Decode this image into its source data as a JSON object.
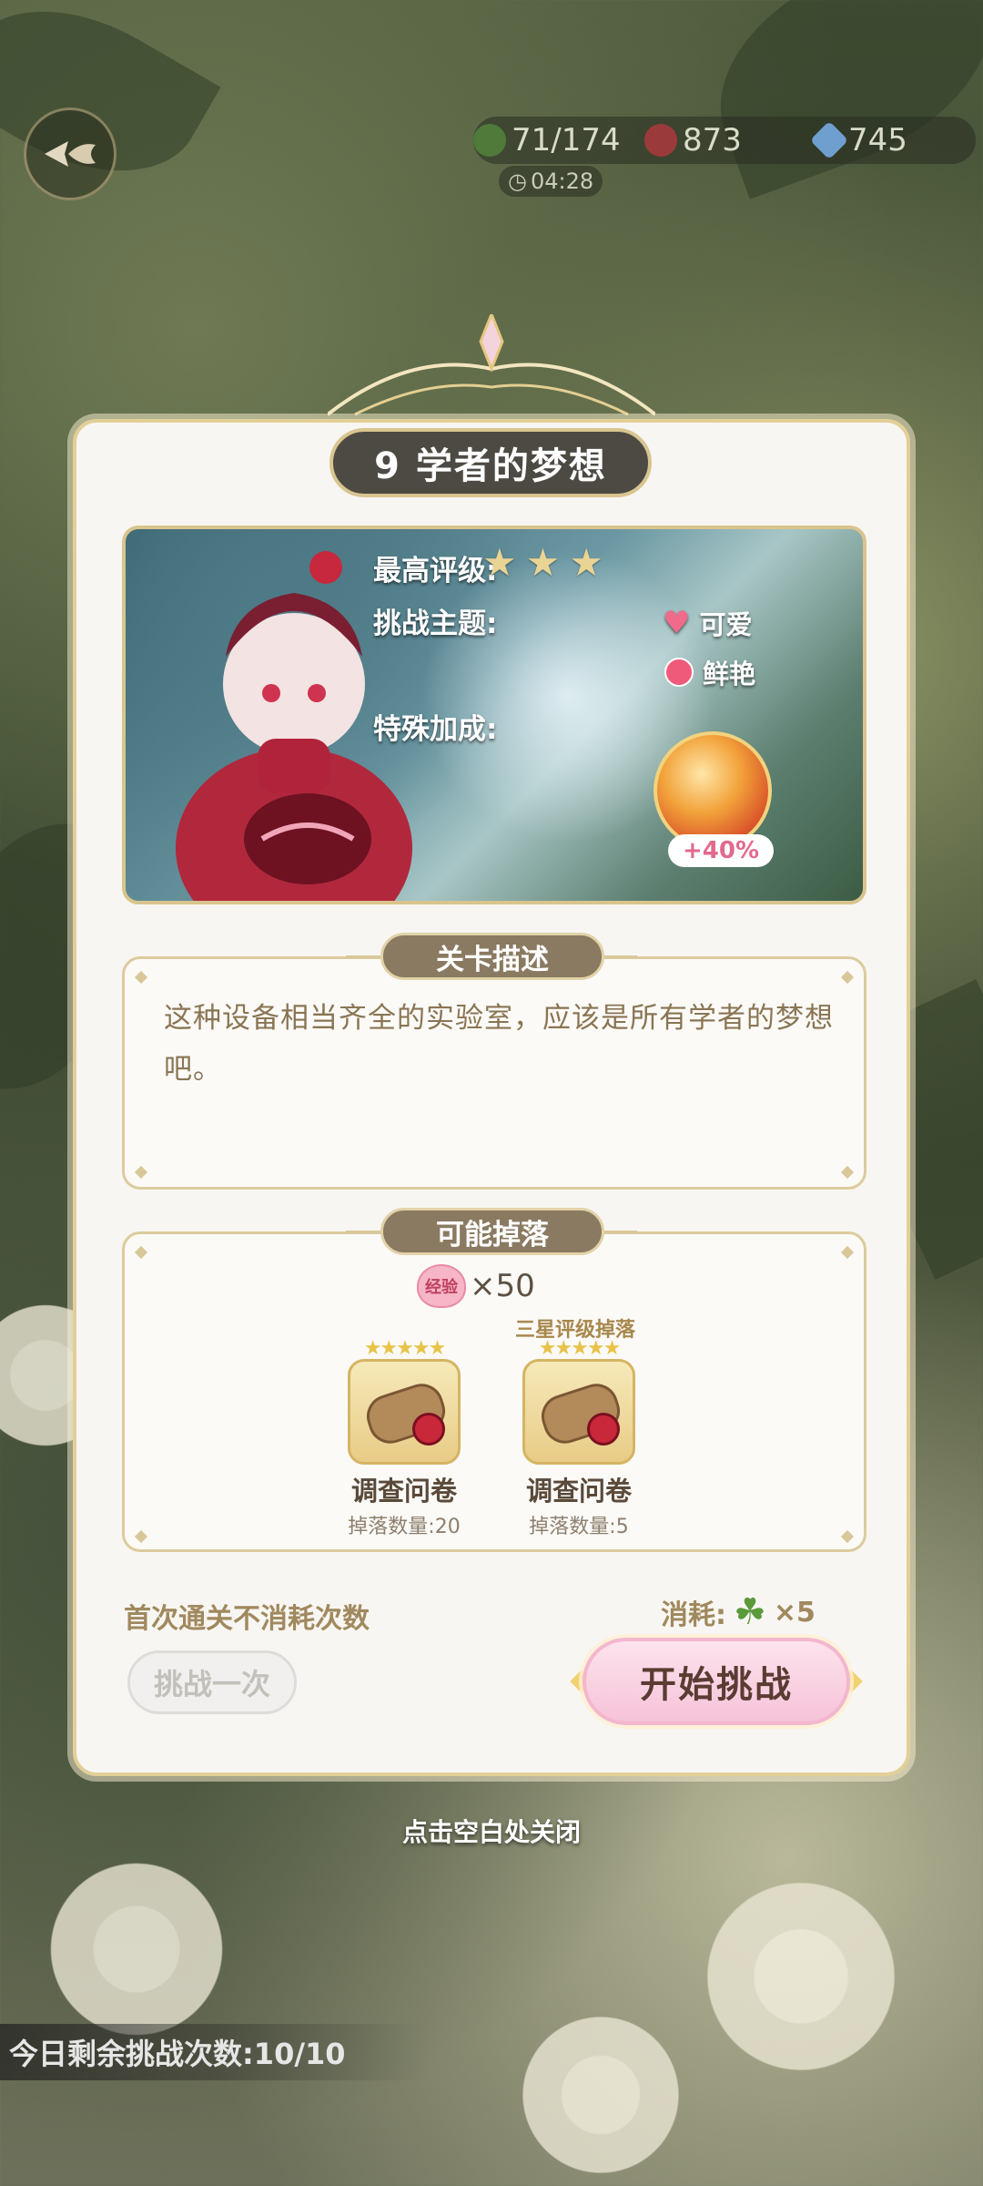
{
  "resources": {
    "stamina": "71/174",
    "roses": "873",
    "gems": "745",
    "timer": "04:28"
  },
  "stage": {
    "title": "9 学者的梦想",
    "best_rating_label": "最高评级:",
    "best_rating_stars": 3,
    "theme_label": "挑战主题:",
    "themes": [
      "可爱",
      "鲜艳"
    ],
    "bonus_label": "特殊加成:",
    "bonus_value": "+40%"
  },
  "description": {
    "header": "关卡描述",
    "text": "这种设备相当齐全的实验室，应该是所有学者的梦想吧。"
  },
  "drops": {
    "header": "可能掉落",
    "exp_icon_text": "经验",
    "exp_amount": "×50",
    "three_star_tag": "三星评级掉落",
    "items": [
      {
        "name": "调查问卷",
        "qty": "掉落数量:20"
      },
      {
        "name": "调查问卷",
        "qty": "掉落数量:5"
      }
    ]
  },
  "footer": {
    "first_clear_note": "首次通关不消耗次数",
    "cost_label": "消耗:",
    "cost_amount": "×5",
    "challenge_once": "挑战一次",
    "start_challenge": "开始挑战"
  },
  "close_hint": "点击空白处关闭",
  "daily_remaining": "今日剩余挑战次数:10/10",
  "colors": {
    "panel_bg": "#f8f6f2",
    "gold_border": "#e2cf98",
    "title_plate": "#4d4a43",
    "section_plate": "#8a7a61",
    "text_brown": "#8a7553",
    "start_button": "#f6c3d8",
    "bonus_pink": "#e26a8c"
  }
}
